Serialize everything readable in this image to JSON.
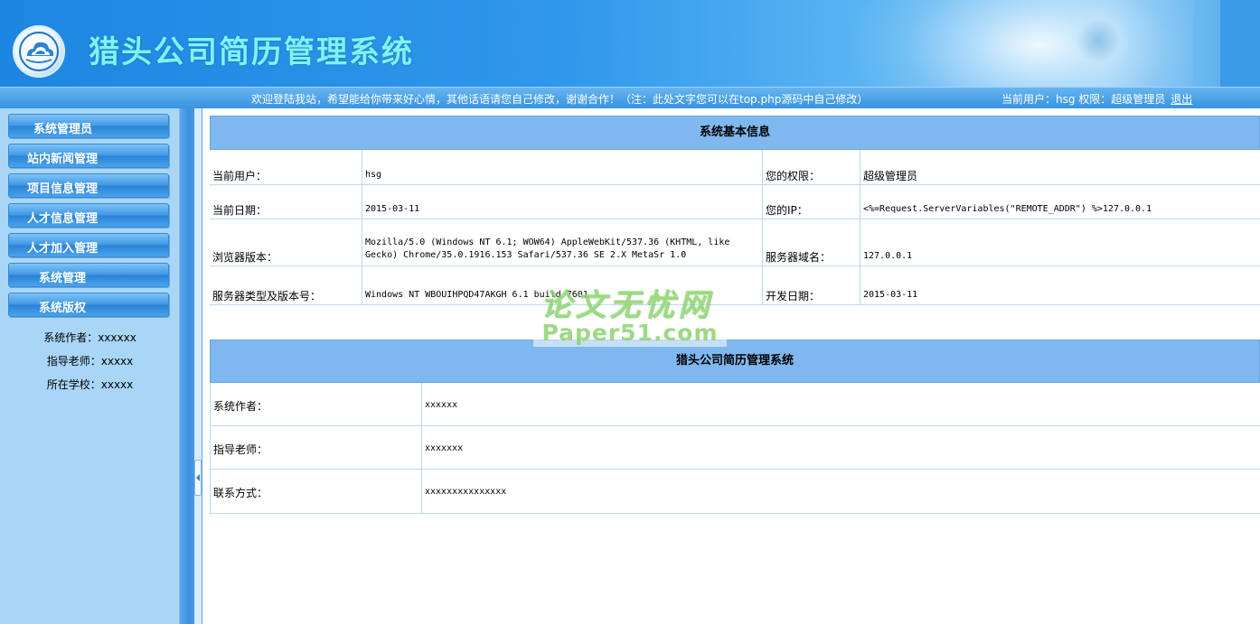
{
  "header": {
    "title": "猎头公司简历管理系统",
    "logo_icon": "cloud-globe-icon"
  },
  "topbar": {
    "welcome": "欢迎登陆我站，希望能给你带来好心情，其他话语请您自己修改，谢谢合作！（注：此处文字您可以在top.php源码中自己修改）",
    "user_prefix": "当前用户：hsg 权限：超级管理员",
    "logout": "退出"
  },
  "sidebar": {
    "menu": [
      {
        "label": "系统管理员"
      },
      {
        "label": "站内新闻管理"
      },
      {
        "label": "项目信息管理"
      },
      {
        "label": "人才信息管理"
      },
      {
        "label": "人才加入管理"
      },
      {
        "label": "系统管理"
      },
      {
        "label": "系统版权"
      }
    ],
    "info": [
      "系统作者：xxxxxx",
      "指导老师：xxxxx",
      "所在学校：xxxxx"
    ]
  },
  "basic_info": {
    "title": "系统基本信息",
    "rows": [
      {
        "label1": "当前用户：",
        "value1": "hsg",
        "label2": "您的权限：",
        "value2": "超级管理员"
      },
      {
        "label1": "当前日期：",
        "value1": "2015-03-11",
        "label2": "您的IP：",
        "value2": "<%=Request.ServerVariables(\"REMOTE_ADDR\") %>127.0.0.1"
      },
      {
        "label1": "浏览器版本：",
        "value1": "Mozilla/5.0 (Windows NT 6.1; WOW64) AppleWebKit/537.36 (KHTML, like Gecko) Chrome/35.0.1916.153 Safari/537.36 SE 2.X MetaSr 1.0",
        "label2": "服务器域名：",
        "value2": "127.0.0.1"
      },
      {
        "label1": "服务器类型及版本号：",
        "value1": "Windows NT WBOUIHPQD47AKGH 6.1 build 7601",
        "label2": "开发日期：",
        "value2": "2015-03-11"
      }
    ]
  },
  "system_info": {
    "title": "猎头公司简历管理系统",
    "rows": [
      {
        "label": "系统作者：",
        "value": "xxxxxx"
      },
      {
        "label": "指导老师：",
        "value": "xxxxxxx"
      },
      {
        "label": "联系方式：",
        "value": "xxxxxxxxxxxxxxx"
      }
    ]
  },
  "watermark": {
    "cn": "论文无忧网",
    "en": "Paper51.com"
  },
  "colors": {
    "header_blue": "#2f98ec",
    "title_cyan": "#7ff3f0",
    "panel_head": "#7fb8ee",
    "sidebar_bg": "#a9d6f7"
  }
}
